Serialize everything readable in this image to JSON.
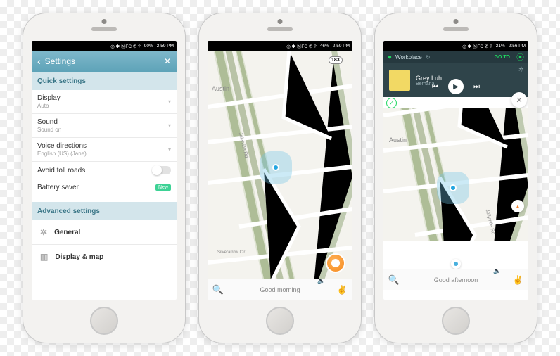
{
  "phone1": {
    "status": {
      "icons": "◎ ✱ ⓃFC ✆ ?",
      "battery": "90%",
      "time": "2:59 PM"
    },
    "header": {
      "back": "‹",
      "title": "Settings",
      "close": "✕"
    },
    "quick_header": "Quick settings",
    "rows": {
      "display": {
        "label": "Display",
        "sub": "Auto"
      },
      "sound": {
        "label": "Sound",
        "sub": "Sound on"
      },
      "voice": {
        "label": "Voice directions",
        "sub": "English (US) (Jane)"
      },
      "toll": {
        "label": "Avoid toll roads"
      },
      "battery": {
        "label": "Battery saver",
        "badge": "New"
      }
    },
    "adv_header": "Advanced settings",
    "adv": {
      "general": "General",
      "display_map": "Display & map"
    }
  },
  "phone2": {
    "status": {
      "icons": "◎ ✱ ⓃFC ✆ ?",
      "battery": "46%",
      "time": "2:59 PM"
    },
    "city": "Austin",
    "route": "183",
    "road": "Jollyville Rd",
    "road2": "Silverarrow Cir",
    "bottom": {
      "greeting": "Good morning"
    }
  },
  "phone3": {
    "status": {
      "icons": "◎ ✱ ⓃFC ✆ ?",
      "battery": "21%",
      "time": "2:56 PM"
    },
    "spotify": {
      "label": "Workplace",
      "goto": "GO TO"
    },
    "music": {
      "title": "Grey Luh",
      "artist": "Berhana"
    },
    "city": "Austin",
    "road": "Jollyville Rd",
    "bottom": {
      "greeting": "Good afternoon"
    }
  }
}
